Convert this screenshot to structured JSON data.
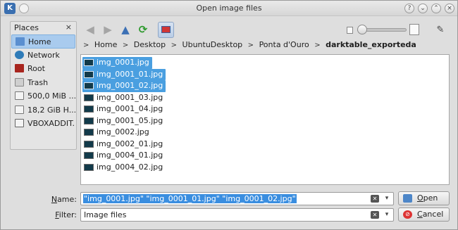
{
  "window": {
    "title": "Open image files",
    "controls": [
      "?",
      "⌄",
      "⌃",
      "×"
    ]
  },
  "places": {
    "header": "Places",
    "close": "×",
    "items": [
      {
        "label": "Home",
        "icon": "home-folder-icon",
        "selected": true
      },
      {
        "label": "Network",
        "icon": "network-icon"
      },
      {
        "label": "Root",
        "icon": "root-folder-icon"
      },
      {
        "label": "Trash",
        "icon": "trash-icon"
      },
      {
        "label": "500,0 MiB ...",
        "icon": "hard-drive-icon"
      },
      {
        "label": "18,2 GiB H...",
        "icon": "hard-drive-icon"
      },
      {
        "label": "VBOXADDIT...",
        "icon": "cdrom-icon"
      }
    ]
  },
  "toolbar": {
    "back": "◀",
    "forward": "▶",
    "up": "▲",
    "reload": "⟳",
    "options": "✎"
  },
  "breadcrumb": {
    "items": [
      "Home",
      "Desktop",
      "UbuntuDesktop",
      "Ponta d'Ouro"
    ],
    "current": "darktable_exporteda",
    "separator": ">"
  },
  "files": [
    {
      "name": "img_0001.jpg",
      "selected": true
    },
    {
      "name": "img_0001_01.jpg",
      "selected": true
    },
    {
      "name": "img_0001_02.jpg",
      "selected": true
    },
    {
      "name": "img_0001_03.jpg",
      "selected": false
    },
    {
      "name": "img_0001_04.jpg",
      "selected": false
    },
    {
      "name": "img_0001_05.jpg",
      "selected": false
    },
    {
      "name": "img_0002.jpg",
      "selected": false
    },
    {
      "name": "img_0002_01.jpg",
      "selected": false
    },
    {
      "name": "img_0004_01.jpg",
      "selected": false
    },
    {
      "name": "img_0004_02.jpg",
      "selected": false
    }
  ],
  "form": {
    "name_label_first": "N",
    "name_label_rest": "ame:",
    "name_value": "\"img_0001.jpg\" \"img_0001_01.jpg\" \"img_0001_02.jpg\"",
    "filter_label_first": "F",
    "filter_label_rest": "ilter:",
    "filter_value": "Image files",
    "open_first": "O",
    "open_rest": "pen",
    "cancel_first": "C",
    "cancel_rest": "ancel"
  },
  "colors": {
    "selection": "#4a9fe0",
    "sidebar_selection": "#a9cbee"
  }
}
